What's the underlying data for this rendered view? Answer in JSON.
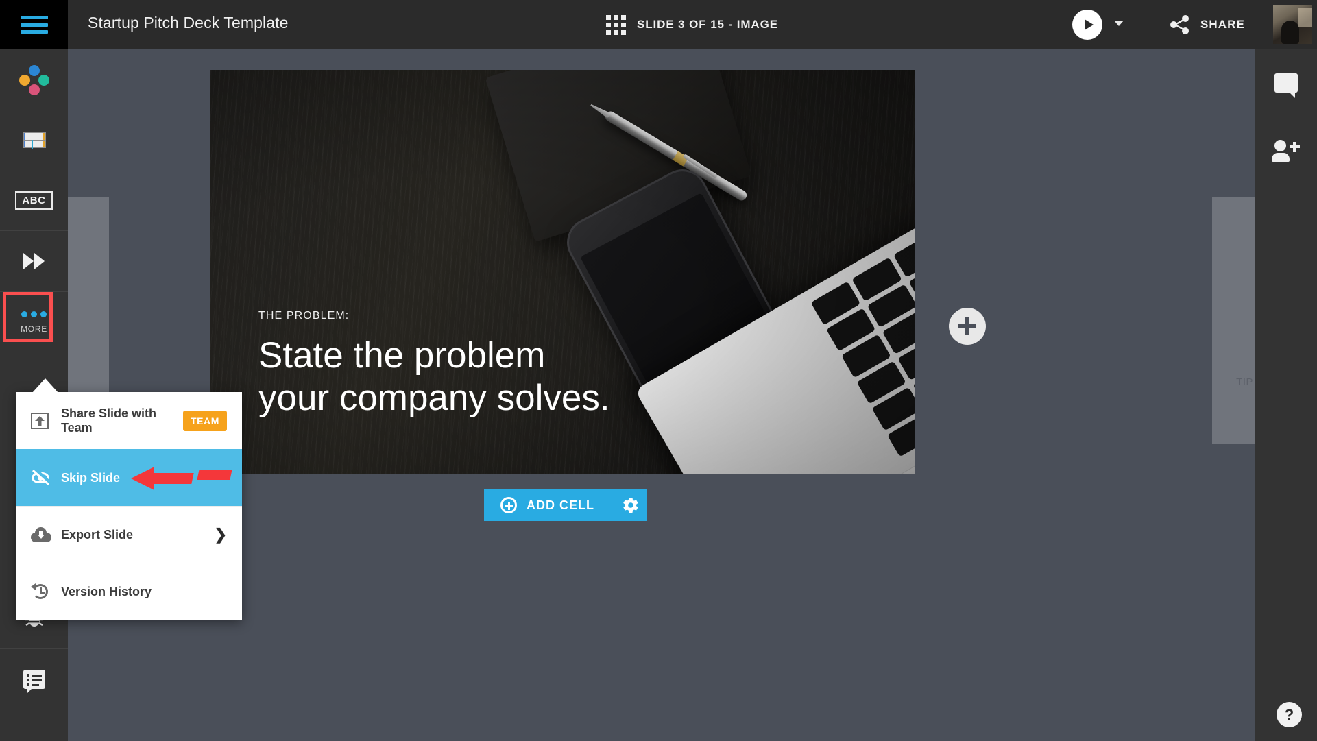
{
  "header": {
    "menu_icon": "hamburger-icon",
    "title": "Startup Pitch Deck Template",
    "slide_indicator": {
      "grid_icon": "grid-icon",
      "label": "SLIDE 3 OF 15 - IMAGE",
      "current": 3,
      "total": 15,
      "slide_type": "IMAGE"
    },
    "present_icon": "play-icon",
    "present_caret_icon": "chevron-down-icon",
    "share_icon": "share-icon",
    "share_label": "SHARE",
    "avatar": "user-avatar"
  },
  "left_rail": {
    "items": [
      {
        "icon": "four-dots-icon",
        "label": ""
      },
      {
        "icon": "layout-icon",
        "label": ""
      },
      {
        "icon": "abc-icon",
        "label": "ABC"
      },
      {
        "icon": "fast-forward-icon",
        "label": ""
      },
      {
        "icon": "more-dots-icon",
        "label": "MORE"
      }
    ],
    "bottom_items": [
      {
        "icon": "bug-icon",
        "label": ""
      },
      {
        "icon": "feedback-icon",
        "label": ""
      }
    ]
  },
  "right_rail": {
    "items": [
      {
        "icon": "comment-bubble-icon",
        "label": ""
      },
      {
        "icon": "add-person-icon",
        "label": ""
      }
    ],
    "help_label": "?"
  },
  "canvas": {
    "prev_panel_label": "",
    "next_panel_label": "TIP",
    "add_slide_icon": "plus-circle-icon",
    "slide": {
      "eyebrow": "THE PROBLEM:",
      "headline": "State the problem your company solves.",
      "background_description": "dark wood desk with notebook, silver pen, black smartphone and laptop keyboard"
    },
    "add_cell": {
      "icon": "plus-circle-icon",
      "label": "ADD CELL",
      "settings_icon": "gear-icon"
    }
  },
  "more_menu": {
    "items": [
      {
        "icon": "upload-icon",
        "label": "Share Slide with Team",
        "badge": "TEAM",
        "active": false,
        "chevron": ""
      },
      {
        "icon": "eye-off-icon",
        "label": "Skip Slide",
        "badge": "",
        "active": true,
        "chevron": ""
      },
      {
        "icon": "cloud-download-icon",
        "label": "Export Slide",
        "badge": "",
        "active": false,
        "chevron": "❯"
      },
      {
        "icon": "clock-rewind-icon",
        "label": "Version History",
        "badge": "",
        "active": false,
        "chevron": ""
      }
    ]
  },
  "annotations": {
    "highlight_target": "MORE",
    "arrow_target": "Skip Slide",
    "highlight_color": "#fa4f4f",
    "arrow_color": "#F4373A"
  },
  "colors": {
    "accent_blue": "#29ABE2",
    "menu_highlight": "#4FBCE6",
    "team_badge": "#F6A21B",
    "topbar": "#2b2b2b",
    "rail": "#333333",
    "canvas": "#4a4f59"
  }
}
